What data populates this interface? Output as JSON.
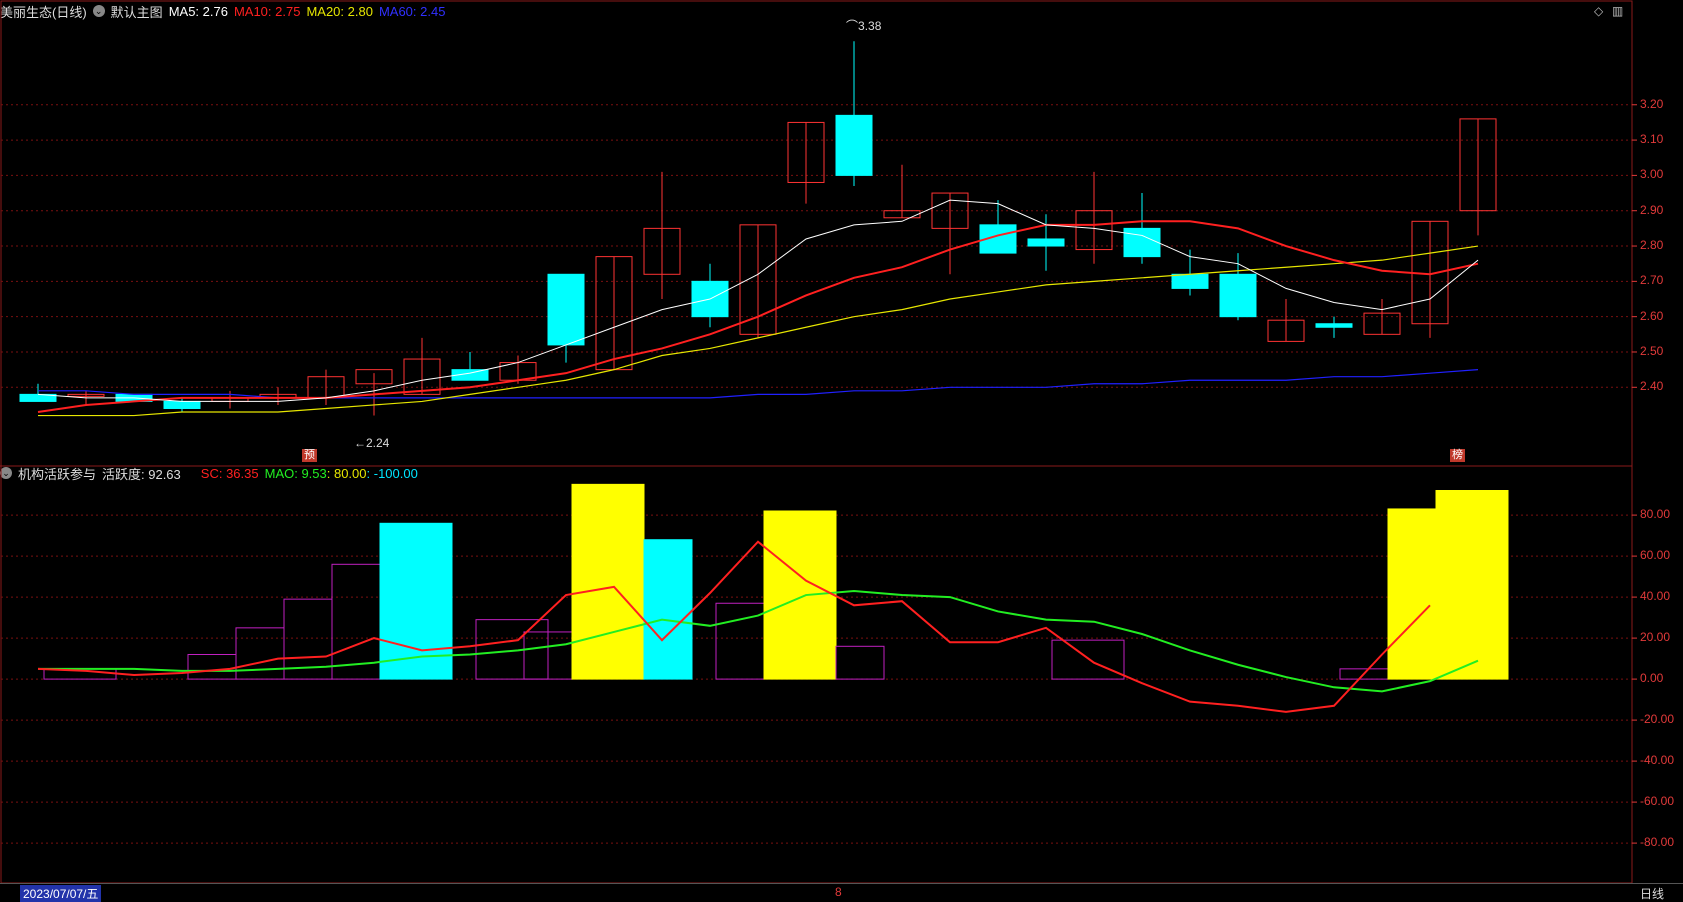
{
  "main_header": {
    "stock": "美丽生态(日线)",
    "menu": "默认主图",
    "ma5": "MA5: 2.76",
    "ma10": "MA10: 2.75",
    "ma20": "MA20: 2.80",
    "ma60": "MA60: 2.45"
  },
  "sub_header": {
    "name": "机构活跃参与",
    "activity": "活跃度: 92.63",
    "sc": "SC: 36.35",
    "mao": "MAO: 9.53",
    "l80": ": 80.00",
    "lneg": ": -100.00"
  },
  "colors": {
    "up": "#ff3333",
    "down": "#00ffff",
    "ma5": "#ffffff",
    "ma10": "#ff2020",
    "ma20": "#e6e600",
    "ma60": "#2020ff",
    "sc": "#ff2020",
    "mao": "#22ee22",
    "bar_yellow": "#ffff00",
    "bar_cyan": "#00ffff",
    "bar_purple": "#c020c0",
    "grid": "#7a1010"
  },
  "price_axis": [
    "3.20",
    "3.10",
    "3.00",
    "2.90",
    "2.80",
    "2.70",
    "2.60",
    "2.50",
    "2.40"
  ],
  "osc_axis": [
    "80.00",
    "60.00",
    "40.00",
    "20.00",
    "0.00",
    "-20.00",
    "-40.00",
    "-60.00",
    "-80.00"
  ],
  "annotations": {
    "high": "3.38",
    "low": "2.24"
  },
  "markers": {
    "left": "预",
    "right": "榜",
    "bottom": "8"
  },
  "date_label": "2023/07/07/五",
  "period_label": "日线",
  "chart_data": [
    {
      "type": "candlestick",
      "candles": [
        {
          "o": 2.38,
          "h": 2.41,
          "l": 2.37,
          "c": 2.36
        },
        {
          "o": 2.38,
          "h": 2.39,
          "l": 2.35,
          "c": 2.38
        },
        {
          "o": 2.38,
          "h": 2.38,
          "l": 2.36,
          "c": 2.36
        },
        {
          "o": 2.36,
          "h": 2.37,
          "l": 2.33,
          "c": 2.34
        },
        {
          "o": 2.36,
          "h": 2.39,
          "l": 2.34,
          "c": 2.37
        },
        {
          "o": 2.37,
          "h": 2.4,
          "l": 2.35,
          "c": 2.38
        },
        {
          "o": 2.37,
          "h": 2.45,
          "l": 2.35,
          "c": 2.43
        },
        {
          "o": 2.41,
          "h": 2.44,
          "l": 2.32,
          "c": 2.45
        },
        {
          "o": 2.38,
          "h": 2.54,
          "l": 2.38,
          "c": 2.48
        },
        {
          "o": 2.45,
          "h": 2.5,
          "l": 2.42,
          "c": 2.42
        },
        {
          "o": 2.42,
          "h": 2.49,
          "l": 2.41,
          "c": 2.47
        },
        {
          "o": 2.72,
          "h": 2.72,
          "l": 2.47,
          "c": 2.52
        },
        {
          "o": 2.45,
          "h": 2.77,
          "l": 2.45,
          "c": 2.77
        },
        {
          "o": 2.72,
          "h": 3.01,
          "l": 2.65,
          "c": 2.85
        },
        {
          "o": 2.7,
          "h": 2.75,
          "l": 2.57,
          "c": 2.6
        },
        {
          "o": 2.55,
          "h": 2.86,
          "l": 2.54,
          "c": 2.86
        },
        {
          "o": 2.98,
          "h": 3.15,
          "l": 2.92,
          "c": 3.15
        },
        {
          "o": 3.17,
          "h": 3.38,
          "l": 2.97,
          "c": 3.0
        },
        {
          "o": 2.88,
          "h": 3.03,
          "l": 2.88,
          "c": 2.9
        },
        {
          "o": 2.85,
          "h": 2.95,
          "l": 2.72,
          "c": 2.95
        },
        {
          "o": 2.86,
          "h": 2.93,
          "l": 2.78,
          "c": 2.78
        },
        {
          "o": 2.82,
          "h": 2.89,
          "l": 2.73,
          "c": 2.8
        },
        {
          "o": 2.79,
          "h": 3.01,
          "l": 2.75,
          "c": 2.9
        },
        {
          "o": 2.85,
          "h": 2.95,
          "l": 2.75,
          "c": 2.77
        },
        {
          "o": 2.72,
          "h": 2.79,
          "l": 2.66,
          "c": 2.68
        },
        {
          "o": 2.72,
          "h": 2.78,
          "l": 2.59,
          "c": 2.6
        },
        {
          "o": 2.53,
          "h": 2.65,
          "l": 2.53,
          "c": 2.59
        },
        {
          "o": 2.58,
          "h": 2.6,
          "l": 2.54,
          "c": 2.57
        },
        {
          "o": 2.55,
          "h": 2.65,
          "l": 2.55,
          "c": 2.61
        },
        {
          "o": 2.58,
          "h": 2.87,
          "l": 2.54,
          "c": 2.87
        },
        {
          "o": 2.9,
          "h": 3.16,
          "l": 2.83,
          "c": 3.16
        }
      ],
      "ma5": [
        2.38,
        2.37,
        2.37,
        2.36,
        2.36,
        2.36,
        2.37,
        2.39,
        2.42,
        2.44,
        2.47,
        2.52,
        2.57,
        2.62,
        2.65,
        2.72,
        2.82,
        2.86,
        2.87,
        2.93,
        2.92,
        2.86,
        2.85,
        2.83,
        2.77,
        2.75,
        2.68,
        2.64,
        2.62,
        2.65,
        2.76
      ],
      "ma10": [
        2.33,
        2.35,
        2.36,
        2.37,
        2.37,
        2.37,
        2.37,
        2.38,
        2.39,
        2.4,
        2.42,
        2.44,
        2.48,
        2.51,
        2.55,
        2.6,
        2.66,
        2.71,
        2.74,
        2.79,
        2.83,
        2.86,
        2.86,
        2.87,
        2.87,
        2.85,
        2.8,
        2.76,
        2.73,
        2.72,
        2.75
      ],
      "ma20": [
        2.32,
        2.32,
        2.32,
        2.33,
        2.33,
        2.33,
        2.34,
        2.35,
        2.36,
        2.38,
        2.4,
        2.42,
        2.45,
        2.49,
        2.51,
        2.54,
        2.57,
        2.6,
        2.62,
        2.65,
        2.67,
        2.69,
        2.7,
        2.71,
        2.72,
        2.73,
        2.74,
        2.75,
        2.76,
        2.78,
        2.8
      ],
      "ma60": [
        2.39,
        2.39,
        2.38,
        2.38,
        2.38,
        2.37,
        2.37,
        2.37,
        2.37,
        2.37,
        2.37,
        2.37,
        2.37,
        2.37,
        2.37,
        2.38,
        2.38,
        2.39,
        2.39,
        2.4,
        2.4,
        2.4,
        2.41,
        2.41,
        2.42,
        2.42,
        2.42,
        2.43,
        2.43,
        2.44,
        2.45
      ],
      "price_range": [
        2.18,
        3.44
      ]
    },
    {
      "type": "bar",
      "bars": [
        {
          "i": 0.5,
          "w": 1.5,
          "v": 5,
          "kind": "purple"
        },
        {
          "i": 3.5,
          "w": 1,
          "v": 12,
          "kind": "purple"
        },
        {
          "i": 4.5,
          "w": 1,
          "v": 25,
          "kind": "purple"
        },
        {
          "i": 5.5,
          "w": 1,
          "v": 39,
          "kind": "purple"
        },
        {
          "i": 6.5,
          "w": 1,
          "v": 56,
          "kind": "purple"
        },
        {
          "i": 7.5,
          "w": 1.5,
          "v": 76,
          "kind": "cyan"
        },
        {
          "i": 9.5,
          "w": 1.5,
          "v": 29,
          "kind": "purple"
        },
        {
          "i": 10.5,
          "w": 1,
          "v": 23,
          "kind": "purple"
        },
        {
          "i": 11.5,
          "w": 1.5,
          "v": 95,
          "kind": "yellow"
        },
        {
          "i": 13,
          "w": 1,
          "v": 68,
          "kind": "cyan"
        },
        {
          "i": 14.5,
          "w": 1,
          "v": 37,
          "kind": "purple"
        },
        {
          "i": 15.5,
          "w": 1.5,
          "v": 82,
          "kind": "yellow"
        },
        {
          "i": 17,
          "w": 1,
          "v": 16,
          "kind": "purple"
        },
        {
          "i": 21.5,
          "w": 1.5,
          "v": 19,
          "kind": "purple"
        },
        {
          "i": 27.5,
          "w": 1,
          "v": 5,
          "kind": "purple"
        },
        {
          "i": 28.5,
          "w": 1,
          "v": 83,
          "kind": "yellow"
        },
        {
          "i": 29.5,
          "w": 1.5,
          "v": 92,
          "kind": "yellow"
        }
      ],
      "sc": [
        5,
        4,
        2,
        3,
        5,
        10,
        11,
        20,
        14,
        16,
        19,
        41,
        45,
        19,
        42,
        67,
        48,
        36,
        38,
        18,
        18,
        25,
        8,
        -2,
        -11,
        -13,
        -16,
        -13,
        12,
        36
      ],
      "mao": [
        5,
        5,
        5,
        4,
        4,
        5,
        6,
        8,
        11,
        12,
        14,
        17,
        23,
        29,
        26,
        31,
        41,
        43,
        41,
        40,
        33,
        29,
        28,
        22,
        14,
        7,
        1,
        -4,
        -6,
        -1,
        9
      ],
      "y_range": [
        -98,
        102
      ]
    }
  ]
}
